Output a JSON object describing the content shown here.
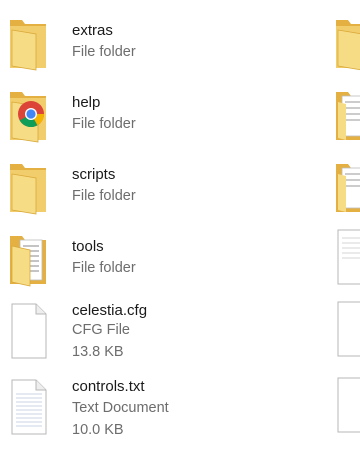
{
  "items": [
    {
      "name": "extras",
      "type": "File folder",
      "icon": "folder-icon"
    },
    {
      "name": "help",
      "type": "File folder",
      "icon": "chrome-folder-icon"
    },
    {
      "name": "scripts",
      "type": "File folder",
      "icon": "folder-icon"
    },
    {
      "name": "tools",
      "type": "File folder",
      "icon": "folder-with-documents-icon"
    },
    {
      "name": "celestia.cfg",
      "type": "CFG File",
      "size": "13.8 KB",
      "icon": "generic-file-icon"
    },
    {
      "name": "controls.txt",
      "type": "Text Document",
      "size": "10.0 KB",
      "icon": "text-file-icon"
    }
  ],
  "colors": {
    "folder_back": "#e8b84a",
    "folder_front": "#f6d77b",
    "text_primary": "#1a1a1a",
    "text_secondary": "#6d6d6d"
  }
}
